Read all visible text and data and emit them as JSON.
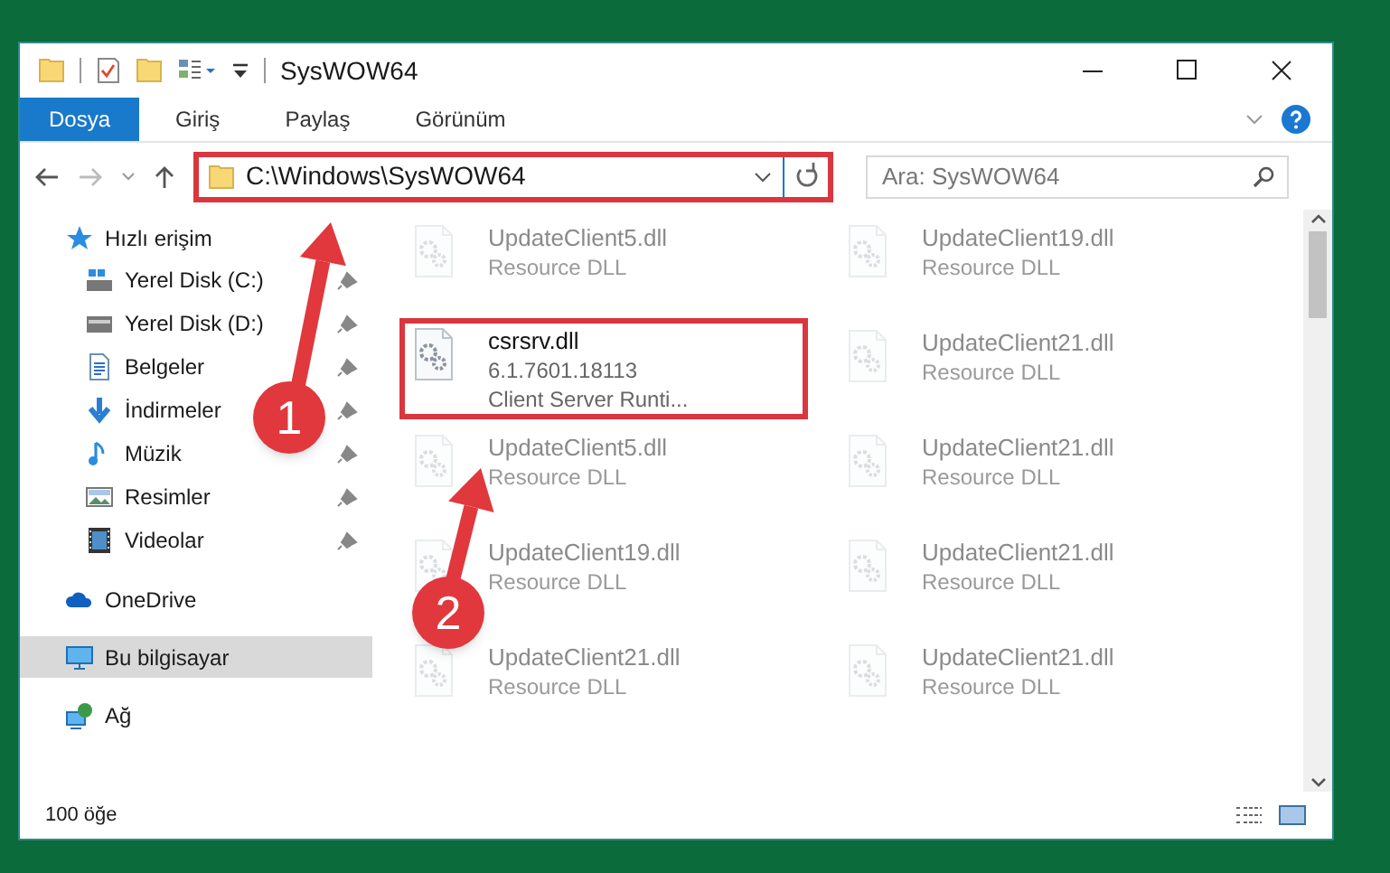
{
  "window": {
    "title": "SysWOW64"
  },
  "ribbon_tabs": [
    {
      "label": "Dosya",
      "selected": true
    },
    {
      "label": "Giriş",
      "selected": false
    },
    {
      "label": "Paylaş",
      "selected": false
    },
    {
      "label": "Görünüm",
      "selected": false
    }
  ],
  "address": {
    "path": "C:\\Windows\\SysWOW64",
    "highlighted": true
  },
  "search": {
    "placeholder": "Ara: SysWOW64"
  },
  "sidebar": [
    {
      "label": "Hızlı erişim",
      "selected": false,
      "children": [
        {
          "label": "Yerel Disk (C:)",
          "pinned": true
        },
        {
          "label": "Yerel Disk (D:)",
          "pinned": true
        },
        {
          "label": "Belgeler",
          "pinned": true
        },
        {
          "label": "İndirmeler",
          "pinned": true
        },
        {
          "label": "Müzik",
          "pinned": true
        },
        {
          "label": "Resimler",
          "pinned": true
        },
        {
          "label": "Videolar",
          "pinned": true
        }
      ]
    },
    {
      "label": "OneDrive",
      "selected": false
    },
    {
      "label": "Bu bilgisayar",
      "selected": true
    },
    {
      "label": "Ağ",
      "selected": false
    }
  ],
  "files": [
    {
      "name": "UpdateClient5.dll",
      "lines": [
        "Resource DLL"
      ],
      "faded": true,
      "highlighted": false
    },
    {
      "name": "UpdateClient19.dll",
      "lines": [
        "Resource DLL"
      ],
      "faded": true,
      "highlighted": false
    },
    {
      "name": "csrsrv.dll",
      "lines": [
        "6.1.7601.18113",
        "Client Server Runti..."
      ],
      "faded": false,
      "highlighted": true
    },
    {
      "name": "UpdateClient21.dll",
      "lines": [
        "Resource DLL"
      ],
      "faded": true,
      "highlighted": false
    },
    {
      "name": "UpdateClient5.dll",
      "lines": [
        "Resource DLL"
      ],
      "faded": true,
      "highlighted": false
    },
    {
      "name": "UpdateClient21.dll",
      "lines": [
        "Resource DLL"
      ],
      "faded": true,
      "highlighted": false
    },
    {
      "name": "UpdateClient19.dll",
      "lines": [
        "Resource DLL"
      ],
      "faded": true,
      "highlighted": false
    },
    {
      "name": "UpdateClient21.dll",
      "lines": [
        "Resource DLL"
      ],
      "faded": true,
      "highlighted": false
    },
    {
      "name": "UpdateClient21.dll",
      "lines": [
        "Resource DLL"
      ],
      "faded": true,
      "highlighted": false
    },
    {
      "name": "UpdateClient21.dll",
      "lines": [
        "Resource DLL"
      ],
      "faded": true,
      "highlighted": false
    }
  ],
  "status_bar": {
    "count": "100 öğe"
  },
  "annotations": [
    {
      "number": "1"
    },
    {
      "number": "2"
    }
  ]
}
